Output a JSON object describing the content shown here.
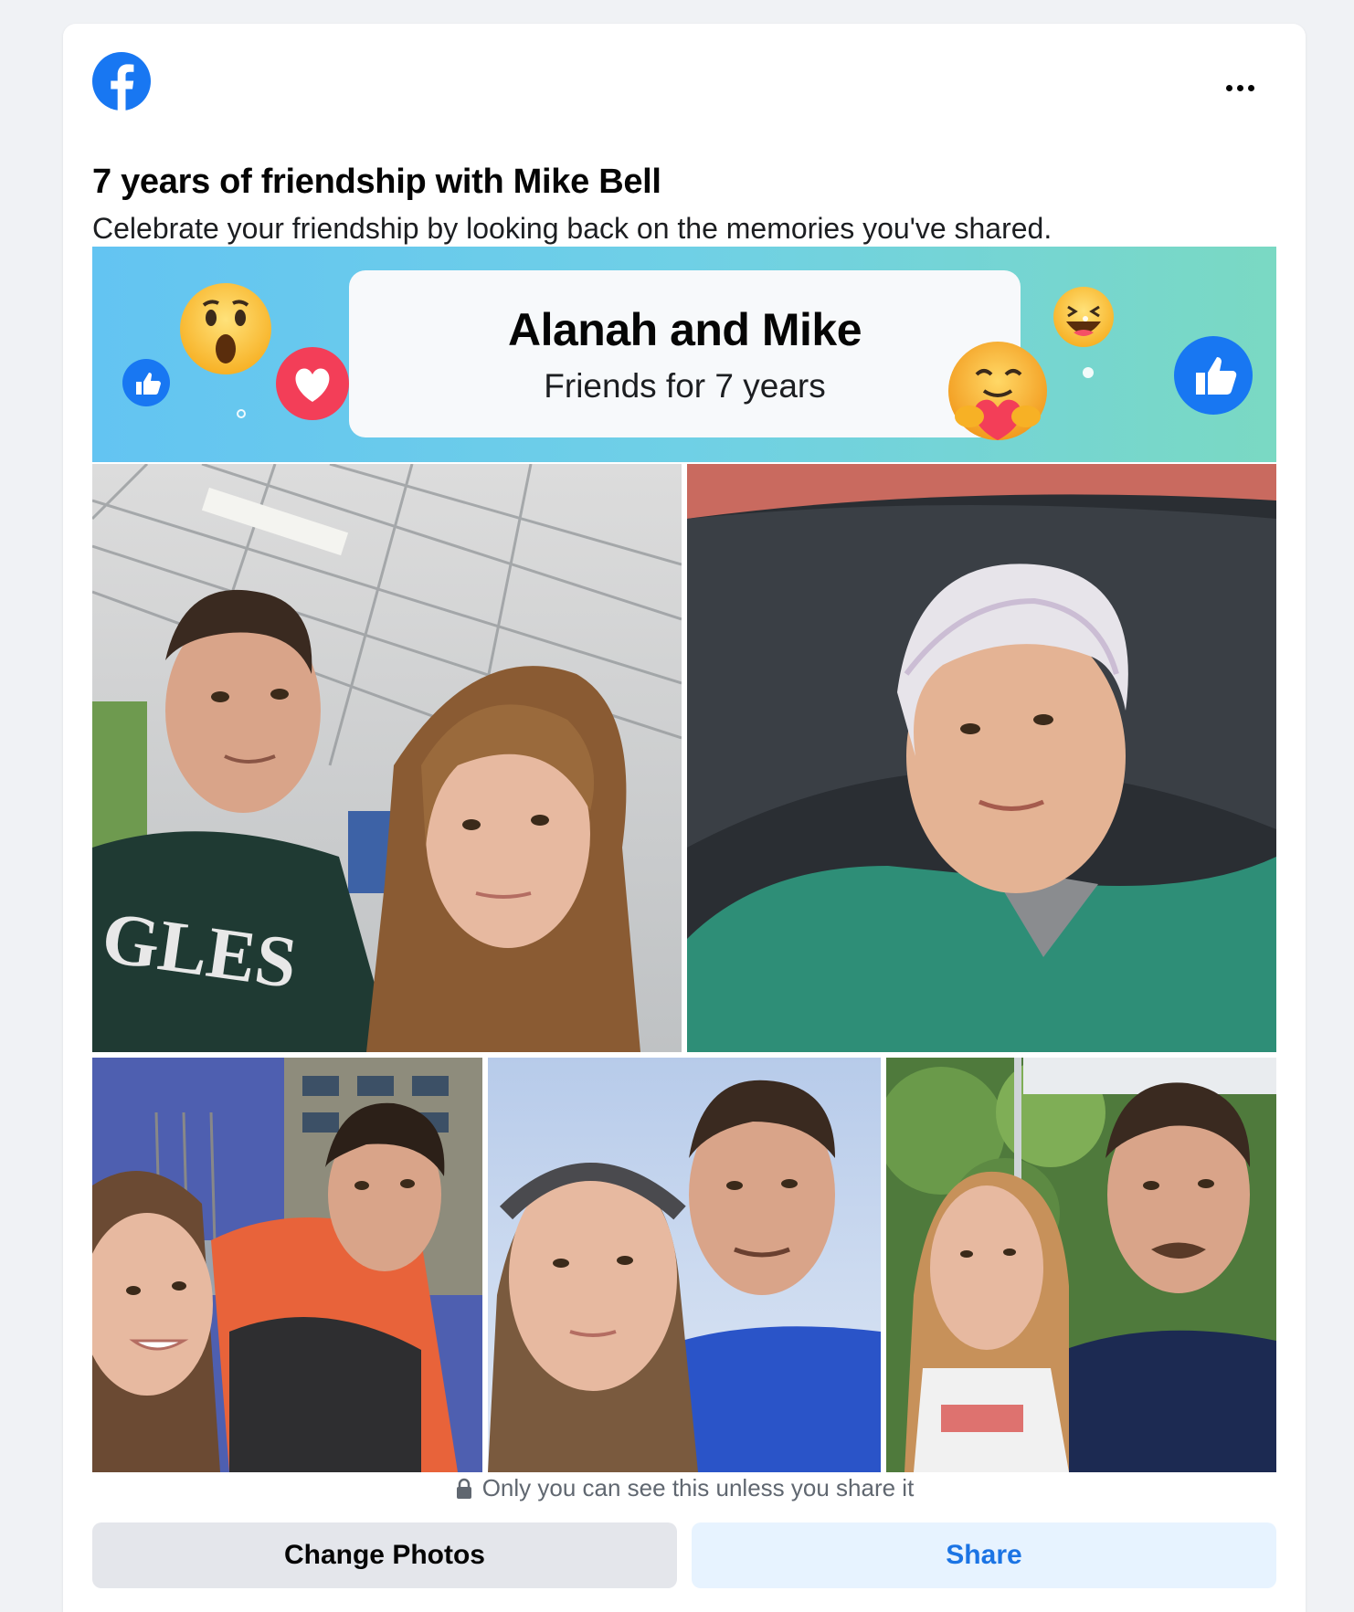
{
  "header": {
    "logo_icon": "facebook-logo-icon",
    "more_icon": "more-options-icon",
    "title": "7 years of friendship with Mike Bell",
    "subtitle": "Celebrate your friendship by looking back on the memories you've shared."
  },
  "banner": {
    "title": "Alanah and Mike",
    "subtitle": "Friends for 7 years",
    "emojis": [
      "like-icon",
      "wow-icon",
      "love-icon",
      "haha-icon",
      "care-icon",
      "like-icon"
    ]
  },
  "photos": [
    {
      "name": "photo-selfie-gym"
    },
    {
      "name": "photo-hairnet-scrubs"
    },
    {
      "name": "photo-selfie-orange"
    },
    {
      "name": "photo-selfie-headband"
    },
    {
      "name": "photo-selfie-park"
    }
  ],
  "privacy": {
    "icon": "lock-icon",
    "text": "Only you can see this unless you share it"
  },
  "actions": {
    "change_label": "Change Photos",
    "share_label": "Share"
  },
  "colors": {
    "brand": "#1877f2",
    "share_text": "#1b74e4",
    "share_bg": "#e7f3ff",
    "secondary_bg": "#e4e6eb",
    "page_bg": "#f0f2f5"
  }
}
